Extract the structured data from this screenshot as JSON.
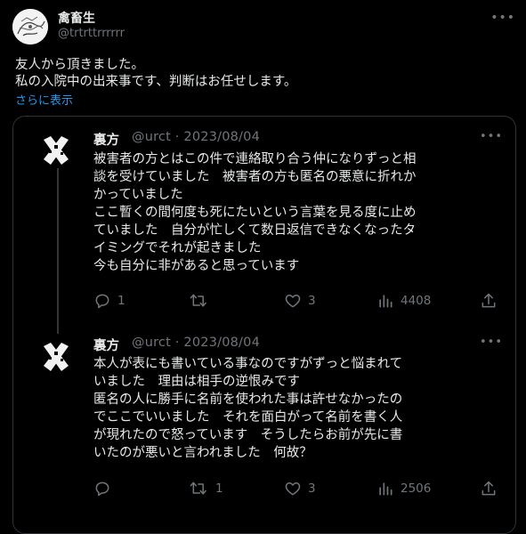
{
  "author": {
    "name": "禽畜生",
    "handle": "@trtrttrrrrrr",
    "avatar_icon": "sketch-avatar-icon"
  },
  "tweet": {
    "line1": "友人から頂きました。",
    "line2": "私の入院中の出来事です、判断はお任せします。",
    "show_more": "さらに表示"
  },
  "quoted": {
    "posts": [
      {
        "name": "裏方",
        "handle_date": "@urct · 2023/08/04",
        "lines": [
          "被害者の方とはこの件で連絡取り合う仲になりずっと相",
          "談を受けていました　被害者の方も匿名の悪意に折れか",
          "かっていました",
          "ここ暫くの間何度も死にたいという言葉を見る度に止め",
          "ていました　自分が忙しくて数日返信できなくなったタ",
          "イミングでそれが起きました",
          "今も自分に非があると思っています"
        ],
        "replies": "1",
        "retweets": "",
        "likes": "3",
        "views": "4408"
      },
      {
        "name": "裏方",
        "handle_date": "@urct · 2023/08/04",
        "lines": [
          "本人が表にも書いている事なのですがずっと悩まれて",
          "いました　理由は相手の逆恨みです",
          "匿名の人に勝手に名前を使われた事は許せなかったの",
          "でここでいいました　それを面白がって名前を書く人",
          "が現れたので怒っています　そうしたらお前が先に書",
          "いたのが悪いと言われました　何故？"
        ],
        "replies": "",
        "retweets": "1",
        "likes": "3",
        "views": "2506"
      }
    ]
  },
  "icons": {
    "more": "more-icon",
    "reply": "reply-icon",
    "retweet": "retweet-icon",
    "like": "like-icon",
    "views": "views-icon",
    "share": "share-icon"
  },
  "colors": {
    "background": "#000000",
    "text": "#e7e9ea",
    "muted": "#71767b",
    "link": "#1d9bf0",
    "border": "#2f3336"
  }
}
